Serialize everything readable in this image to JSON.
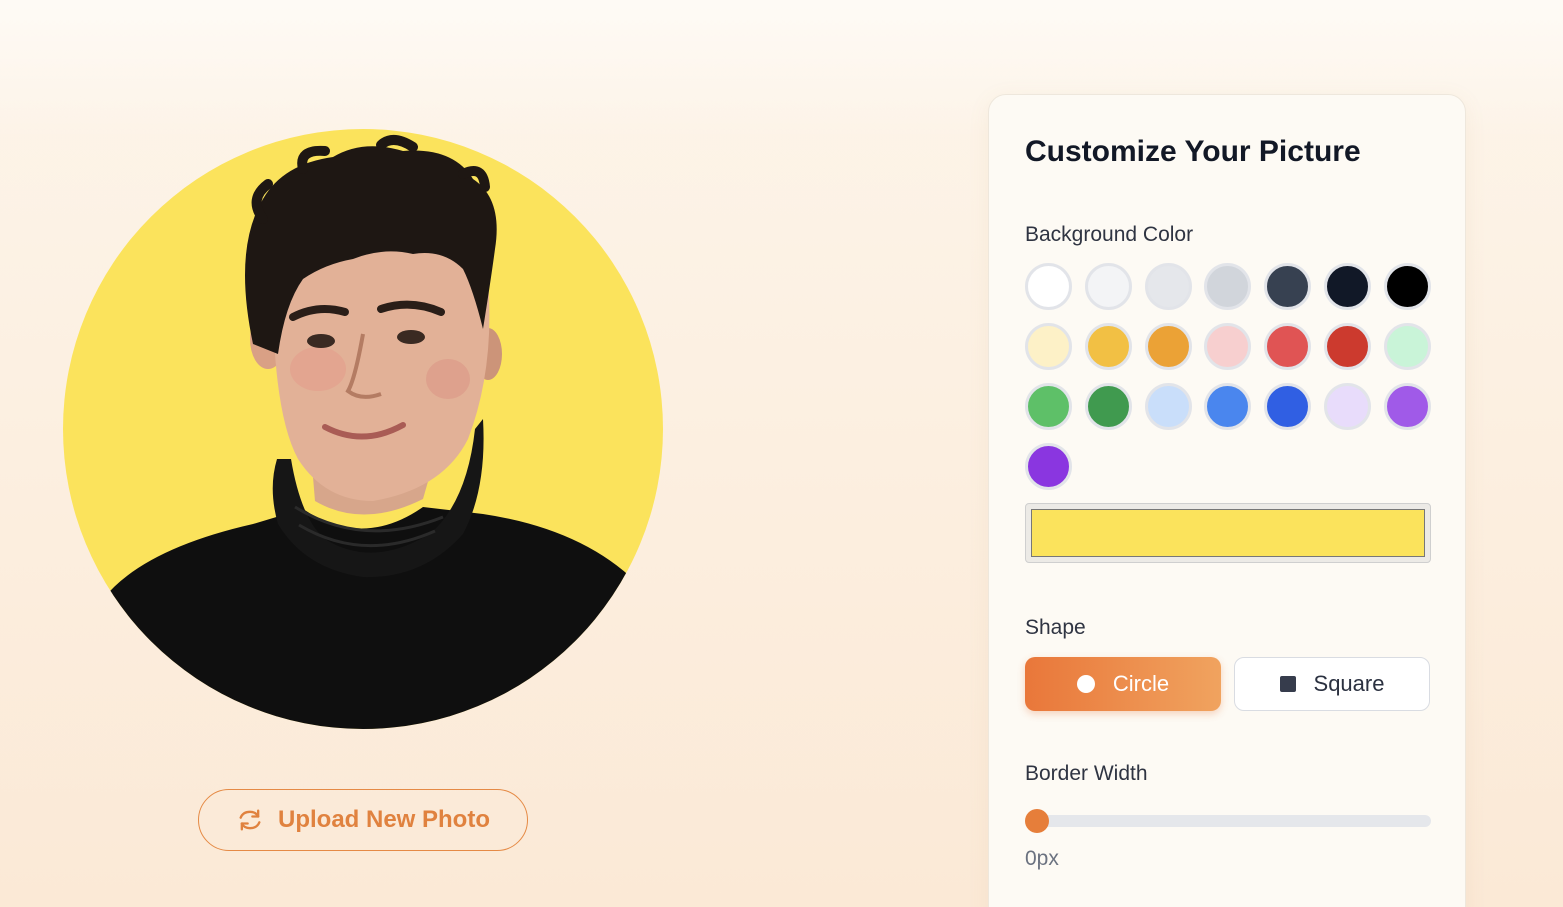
{
  "preview": {
    "background_color": "#fbe35c",
    "shape": "Circle",
    "upload_label": "Upload New Photo"
  },
  "panel": {
    "title": "Customize Your Picture",
    "background_color_label": "Background Color",
    "swatch_colors": [
      "#ffffff",
      "#f3f4f6",
      "#e5e7eb",
      "#d1d5db",
      "#374151",
      "#111827",
      "#000000",
      "#fdf1c7",
      "#f2c044",
      "#eba236",
      "#f7cfcf",
      "#e05454",
      "#cc3a2e",
      "#c9f4d8",
      "#5ec068",
      "#409a4f",
      "#c9defa",
      "#4a86ee",
      "#305fe3",
      "#e8dcfb",
      "#a05ae8",
      "#8a36e0"
    ],
    "selected_color": "#fbe35c",
    "shape_label": "Shape",
    "shape_options": [
      "Circle",
      "Square"
    ],
    "selected_shape": "Circle",
    "border_width_label": "Border Width",
    "border_width_value": "0px",
    "border_width_fraction": 0
  },
  "colors": {
    "accent": "#e67e3a",
    "accent_light": "#f0a35f"
  },
  "icons": {
    "upload": "refresh-icon",
    "circle": "circle-icon",
    "square": "square-icon"
  }
}
